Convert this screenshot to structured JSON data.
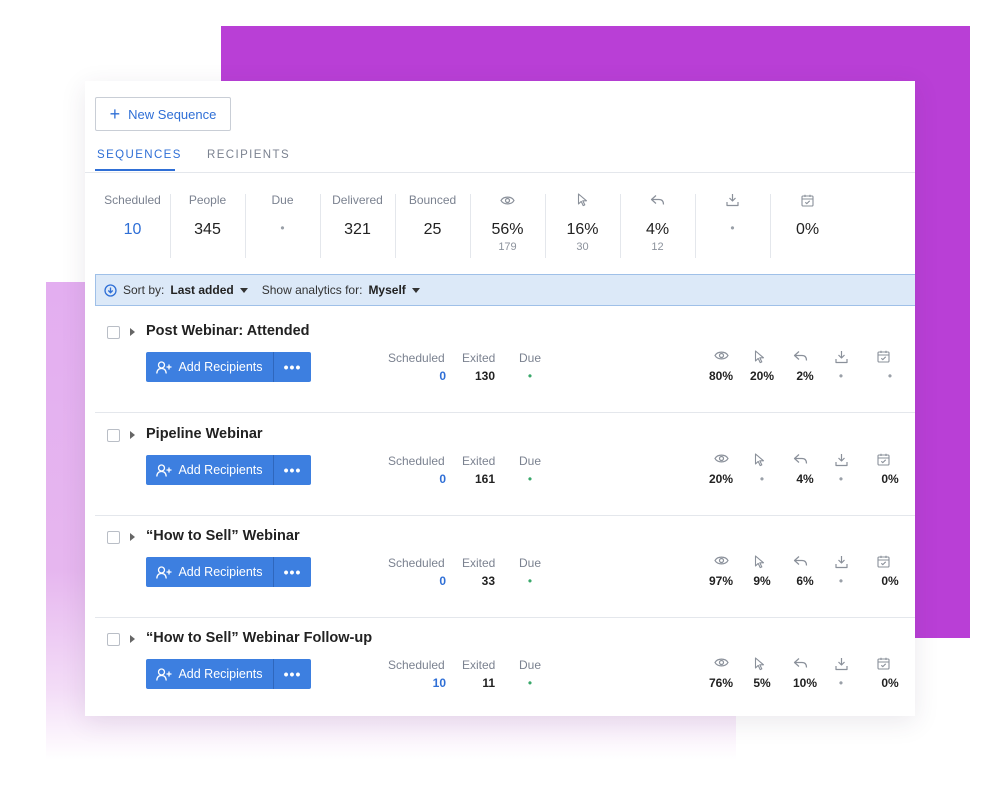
{
  "toolbar": {
    "new_sequence_label": "New Sequence"
  },
  "tabs": [
    {
      "label": "SEQUENCES",
      "active": true
    },
    {
      "label": "RECIPIENTS",
      "active": false
    }
  ],
  "summary": {
    "scheduled": {
      "label": "Scheduled",
      "value": "10"
    },
    "people": {
      "label": "People",
      "value": "345"
    },
    "due": {
      "label": "Due",
      "value": "•"
    },
    "delivered": {
      "label": "Delivered",
      "value": "321"
    },
    "bounced": {
      "label": "Bounced",
      "value": "25"
    },
    "opened": {
      "icon": "eye-icon",
      "value": "56%",
      "count": "179"
    },
    "clicked": {
      "icon": "cursor-icon",
      "value": "16%",
      "count": "30"
    },
    "replied": {
      "icon": "reply-icon",
      "value": "4%",
      "count": "12"
    },
    "downloaded": {
      "icon": "download-icon",
      "value": "•"
    },
    "meetings": {
      "icon": "calendar-icon",
      "value": "0%"
    }
  },
  "sort_bar": {
    "sort_label": "Sort by:",
    "sort_value": "Last added",
    "analytics_label": "Show analytics for:",
    "analytics_value": "Myself"
  },
  "column_labels": {
    "scheduled": "Scheduled",
    "exited": "Exited",
    "due": "Due"
  },
  "sequences": [
    {
      "title": "Post Webinar: Attended",
      "add_label": "Add Recipients",
      "more": "•••",
      "scheduled": "0",
      "exited": "130",
      "due": "•",
      "opened": "80%",
      "clicked": "20%",
      "replied": "2%",
      "downloaded": "•",
      "meetings": "•"
    },
    {
      "title": "Pipeline Webinar",
      "add_label": "Add Recipients",
      "more": "•••",
      "scheduled": "0",
      "exited": "161",
      "due": "•",
      "opened": "20%",
      "clicked": "•",
      "replied": "4%",
      "downloaded": "•",
      "meetings": "0%"
    },
    {
      "title": "“How to Sell” Webinar",
      "add_label": "Add Recipients",
      "more": "•••",
      "scheduled": "0",
      "exited": "33",
      "due": "•",
      "opened": "97%",
      "clicked": "9%",
      "replied": "6%",
      "downloaded": "•",
      "meetings": "0%"
    },
    {
      "title": "“How to Sell” Webinar Follow-up",
      "add_label": "Add Recipients",
      "more": "•••",
      "scheduled": "10",
      "exited": "11",
      "due": "•",
      "opened": "76%",
      "clicked": "5%",
      "replied": "10%",
      "downloaded": "•",
      "meetings": "0%"
    }
  ],
  "colors": {
    "accent": "#2f6fd6",
    "button": "#3d7fe0",
    "backdrop": "#b93fd6",
    "due_dot": "#3aa86b"
  }
}
